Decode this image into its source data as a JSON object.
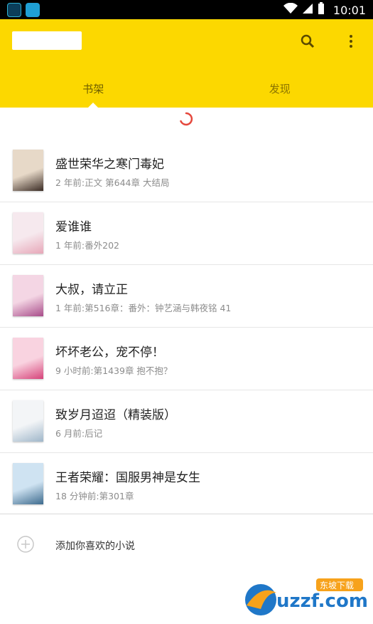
{
  "status_bar": {
    "time": "10:01"
  },
  "tabs": [
    {
      "label": "书架",
      "active": true
    },
    {
      "label": "发现",
      "active": false
    }
  ],
  "actions": {
    "search_icon": "search-icon",
    "more_icon": "more-vert-icon"
  },
  "books": [
    {
      "title": "盛世荣华之寒门毒妃",
      "meta": "2 年前:正文 第644章 大结局",
      "cover_color": "#e7d9c8",
      "cover_accent": "#3a2b24"
    },
    {
      "title": "爱谁谁",
      "meta": "1 年前:番外202",
      "cover_color": "#f6e9ee",
      "cover_accent": "#e7a7b8"
    },
    {
      "title": "大叔，请立正",
      "meta": "1 年前:第516章：番外：钟艺涵与韩夜铭 41",
      "cover_color": "#f4d6e4",
      "cover_accent": "#a84c8a"
    },
    {
      "title": "坏坏老公，宠不停！",
      "meta": "9 小时前:第1439章 抱不抱？",
      "cover_color": "#f9d3e0",
      "cover_accent": "#d6437a"
    },
    {
      "title": "致岁月迢迢（精装版）",
      "meta": "6 月前:后记",
      "cover_color": "#f3f5f7",
      "cover_accent": "#9fb6c9"
    },
    {
      "title": "王者荣耀：国服男神是女生",
      "meta": "18 分钟前:第301章",
      "cover_color": "#cfe3f2",
      "cover_accent": "#3d6b8e"
    }
  ],
  "add_prompt": "添加你喜欢的小说",
  "watermark": {
    "text": "uzzf.com",
    "sub": "东坡下载"
  },
  "colors": {
    "accent": "#fcd800",
    "divider": "#e6e6e6"
  }
}
